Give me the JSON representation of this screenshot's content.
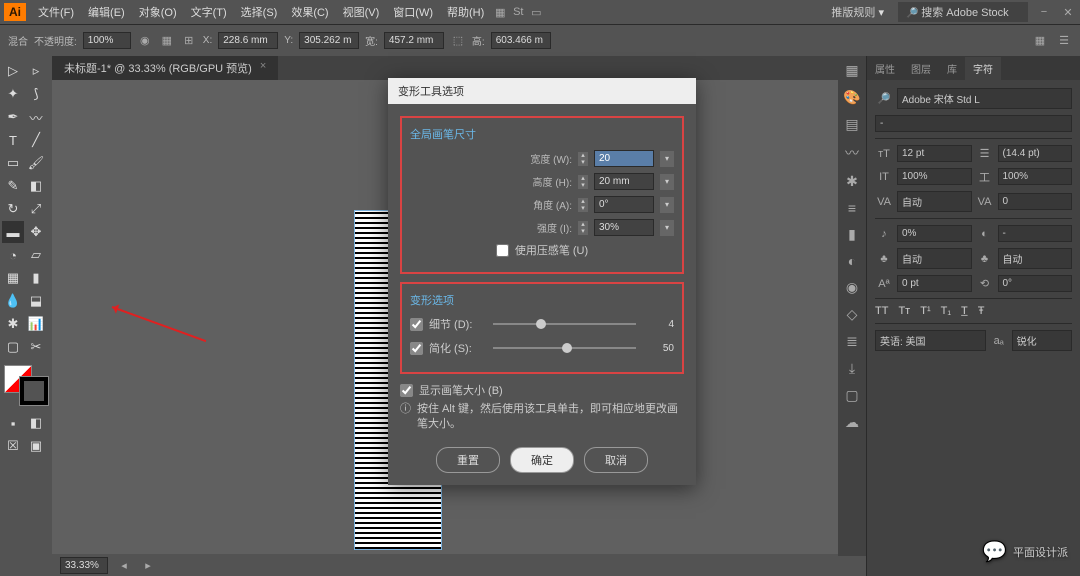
{
  "menu": {
    "items": [
      "文件(F)",
      "编辑(E)",
      "对象(O)",
      "文字(T)",
      "选择(S)",
      "效果(C)",
      "视图(V)",
      "窗口(W)",
      "帮助(H)"
    ],
    "workspace": "推版规则",
    "search_ph": "搜索 Adobe Stock"
  },
  "ctrl": {
    "blend": "混合",
    "opacity_lbl": "不透明度:",
    "opacity": "100%",
    "x_lbl": "X:",
    "x": "228.6 mm",
    "y_lbl": "Y:",
    "y": "305.262 m",
    "w_lbl": "宽:",
    "w": "457.2 mm",
    "h_lbl": "高:",
    "h": "603.466 m"
  },
  "doc": {
    "tab": "未标题-1* @ 33.33% (RGB/GPU 预览)",
    "zoom": "33.33%"
  },
  "dialog": {
    "title": "变形工具选项",
    "group1": "全局画笔尺寸",
    "width_lbl": "宽度 (W):",
    "width": "20",
    "height_lbl": "高度 (H):",
    "height": "20 mm",
    "angle_lbl": "角度 (A):",
    "angle": "0°",
    "intensity_lbl": "强度 (I):",
    "intensity": "30%",
    "pressure": "使用压感笔 (U)",
    "group2": "变形选项",
    "detail_lbl": "细节 (D):",
    "detail": "4",
    "simplify_lbl": "简化 (S):",
    "simplify": "50",
    "show_brush": "显示画笔大小 (B)",
    "hint": "按住 Alt 键，然后使用该工具单击，即可相应地更改画笔大小。",
    "reset": "重置",
    "ok": "确定",
    "cancel": "取消"
  },
  "char": {
    "tabs": [
      "属性",
      "图层",
      "库",
      "字符"
    ],
    "font": "Adobe 宋体 Std L",
    "style": "-",
    "size": "12 pt",
    "leading": "(14.4 pt)",
    "vscale": "100%",
    "hscale": "100%",
    "kerning": "自动",
    "tracking": "0",
    "opt1": "0%",
    "opt2": "-",
    "auto1": "自动",
    "auto2": "自动",
    "baseline": "0 pt",
    "rotate": "0°",
    "lang": "英语: 美国",
    "aa": "锐化"
  },
  "watermark": "平面设计派"
}
